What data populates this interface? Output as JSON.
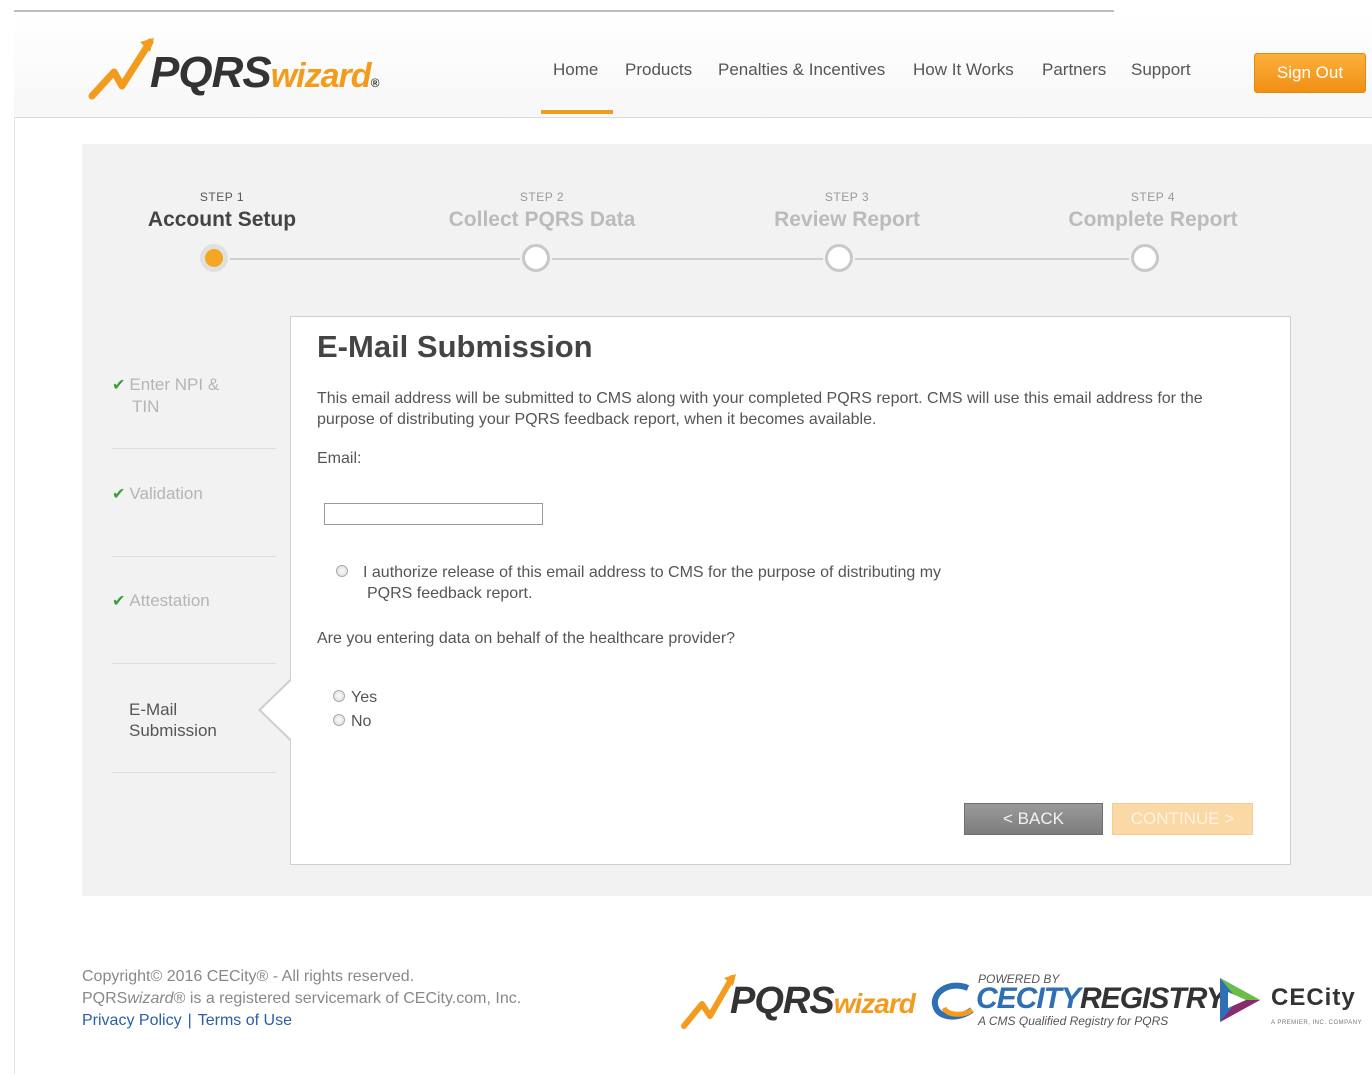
{
  "header": {
    "logo": {
      "main": "PQRS",
      "accent": "wizard",
      "mark": "®"
    },
    "nav": [
      {
        "label": "Home"
      },
      {
        "label": "Products"
      },
      {
        "label": "Penalties & Incentives"
      },
      {
        "label": "How It Works"
      },
      {
        "label": "Partners"
      },
      {
        "label": "Support"
      }
    ],
    "active_nav": "Home",
    "signout_label": "Sign Out"
  },
  "steps": [
    {
      "num": "STEP 1",
      "title": "Account Setup",
      "active": true
    },
    {
      "num": "STEP 2",
      "title": "Collect PQRS Data",
      "active": false
    },
    {
      "num": "STEP 3",
      "title": "Review Report",
      "active": false
    },
    {
      "num": "STEP 4",
      "title": "Complete Report",
      "active": false
    }
  ],
  "subnav": [
    {
      "label_line1": "Enter NPI &",
      "label_line2": "TIN",
      "done": true
    },
    {
      "label_line1": "Validation",
      "label_line2": "",
      "done": true
    },
    {
      "label_line1": "Attestation",
      "label_line2": "",
      "done": true
    },
    {
      "label_line1": "E-Mail",
      "label_line2": "Submission",
      "done": false,
      "current": true
    }
  ],
  "form": {
    "title": "E-Mail Submission",
    "description": "This email address will be submitted to CMS along with your completed PQRS report. CMS will use this email address for the purpose of distributing your PQRS feedback report, when it becomes available.",
    "email_label": "Email:",
    "email_value": "",
    "authorize_line1": "I authorize release of this email address to CMS for the purpose of distributing my",
    "authorize_line2": "PQRS feedback report.",
    "question": "Are you entering data on behalf of the healthcare provider?",
    "options": [
      {
        "label": "Yes"
      },
      {
        "label": "No"
      }
    ],
    "back_label": "<  BACK",
    "continue_label": "CONTINUE  >"
  },
  "footer": {
    "copyright": "Copyright© 2016 CECity® - All rights reserved.",
    "servicemark_brand": "PQRS",
    "servicemark_brand_italic": "wizard",
    "servicemark_rest": "® is a registered servicemark of CECity.com, Inc.",
    "privacy": "Privacy Policy",
    "separator": "|",
    "terms": "Terms of Use",
    "logo_pqrs": {
      "main": "PQRS",
      "accent": "wizard"
    },
    "registry_logo": {
      "powered": "POWERED BY",
      "ce": "CECITY",
      "registry": "REGISTRY",
      "tagline": "A CMS Qualified Registry for PQRS"
    },
    "cecity_logo": {
      "name": "CECity",
      "tagline": "A PREMIER, INC. COMPANY"
    }
  },
  "colors": {
    "accent": "#f29b1d",
    "check": "#3c9d3c",
    "link": "#2a5ea8"
  }
}
